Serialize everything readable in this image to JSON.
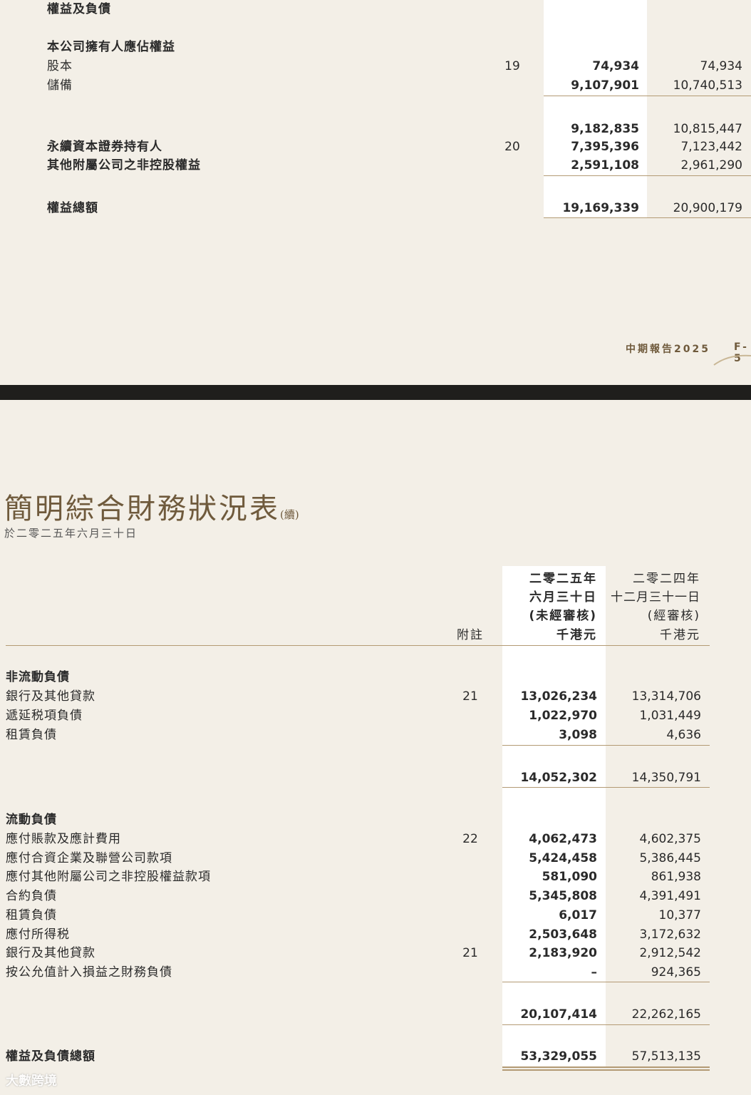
{
  "top_page": {
    "section_title": "權益及負債",
    "subsection_title": "本公司擁有人應佔權益",
    "rows_a": [
      {
        "label": "股本",
        "bold": false,
        "note": "19",
        "v1": "74,934",
        "v2": "74,934"
      },
      {
        "label": "儲備",
        "bold": false,
        "note": "",
        "v1": "9,107,901",
        "v2": "10,740,513"
      }
    ],
    "subtotal": {
      "v1": "9,182,835",
      "v2": "10,815,447"
    },
    "rows_b": [
      {
        "label": "永續資本證券持有人",
        "bold": true,
        "note": "20",
        "v1": "7,395,396",
        "v2": "7,123,442"
      },
      {
        "label": "其他附屬公司之非控股權益",
        "bold": true,
        "note": "",
        "v1": "2,591,108",
        "v2": "2,961,290"
      }
    ],
    "total": {
      "label": "權益總額",
      "v1": "19,169,339",
      "v2": "20,900,179"
    },
    "footer_report": "中期報告2025",
    "footer_page": "F-5"
  },
  "bottom_page": {
    "title": "簡明綜合財務狀況表",
    "title_suffix": "(續)",
    "subtitle": "於二零二五年六月三十日",
    "headers": {
      "note": "附註",
      "col1": [
        "二零二五年",
        "六月三十日",
        "(未經審核)",
        "千港元"
      ],
      "col2": [
        "二零二四年",
        "十二月三十一日",
        "(經審核)",
        "千港元"
      ]
    },
    "noncurrent_title": "非流動負債",
    "noncurrent_rows": [
      {
        "label": "銀行及其他貸款",
        "note": "21",
        "v1": "13,026,234",
        "v2": "13,314,706"
      },
      {
        "label": "遞延税項負債",
        "note": "",
        "v1": "1,022,970",
        "v2": "1,031,449"
      },
      {
        "label": "租賃負債",
        "note": "",
        "v1": "3,098",
        "v2": "4,636"
      }
    ],
    "noncurrent_total": {
      "v1": "14,052,302",
      "v2": "14,350,791"
    },
    "current_title": "流動負債",
    "current_rows": [
      {
        "label": "應付賬款及應計費用",
        "note": "22",
        "v1": "4,062,473",
        "v2": "4,602,375"
      },
      {
        "label": "應付合資企業及聯營公司款項",
        "note": "",
        "v1": "5,424,458",
        "v2": "5,386,445"
      },
      {
        "label": "應付其他附屬公司之非控股權益款項",
        "note": "",
        "v1": "581,090",
        "v2": "861,938"
      },
      {
        "label": "合約負債",
        "note": "",
        "v1": "5,345,808",
        "v2": "4,391,491"
      },
      {
        "label": "租賃負債",
        "note": "",
        "v1": "6,017",
        "v2": "10,377"
      },
      {
        "label": "應付所得税",
        "note": "",
        "v1": "2,503,648",
        "v2": "3,172,632"
      },
      {
        "label": "銀行及其他貸款",
        "note": "21",
        "v1": "2,183,920",
        "v2": "2,912,542"
      },
      {
        "label": "按公允值計入損益之財務負債",
        "note": "",
        "v1": "–",
        "v2": "924,365"
      }
    ],
    "current_total": {
      "v1": "20,107,414",
      "v2": "22,262,165"
    },
    "grand_total": {
      "label": "權益及負債總額",
      "v1": "53,329,055",
      "v2": "57,513,135"
    }
  },
  "watermark": "大數跨境"
}
